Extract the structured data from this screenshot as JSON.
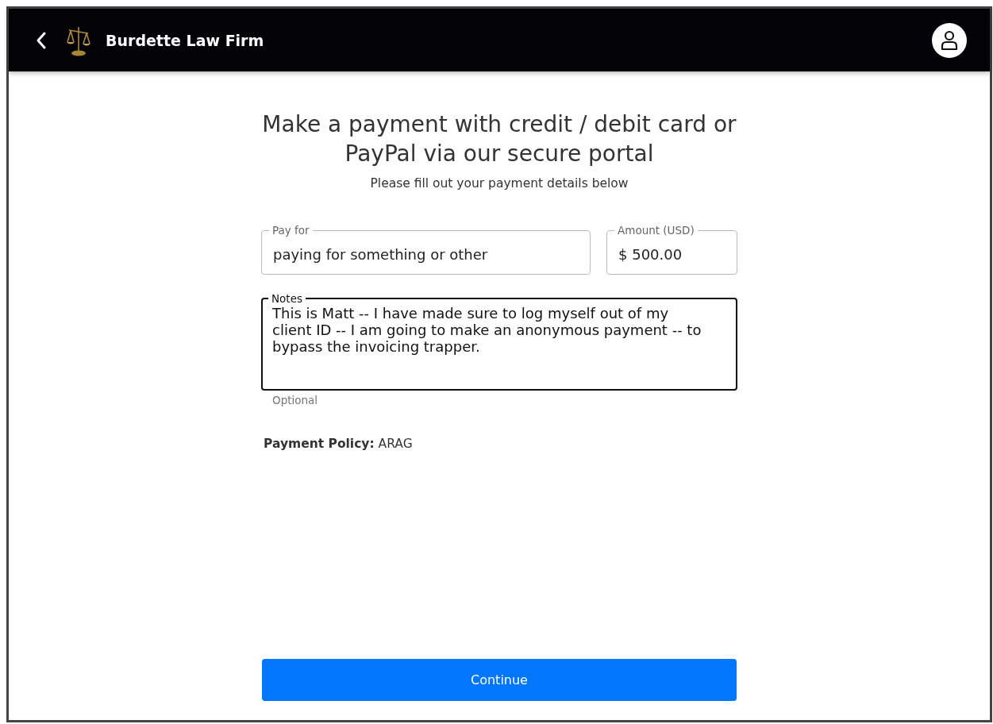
{
  "header": {
    "title": "Burdette Law Firm"
  },
  "heading": "Make a payment with credit / debit card or PayPal via our secure portal",
  "subheading": "Please fill out your payment details below",
  "fields": [
    {
      "label": "Pay for",
      "value": "paying for something or other",
      "focused": false
    },
    {
      "label": "Amount (USD)",
      "value": "$ 500.00",
      "focused": false
    }
  ],
  "notes": {
    "label": "Notes",
    "value": "This is Matt -- I have made sure to log myself out of my client ID -- I am going to make an anonymous payment -- to bypass the invoicing trapper. ",
    "focused": true,
    "helper": "Optional"
  },
  "policy": "**Payment Policy:** ARAG",
  "continue_button": "Continue"
}
